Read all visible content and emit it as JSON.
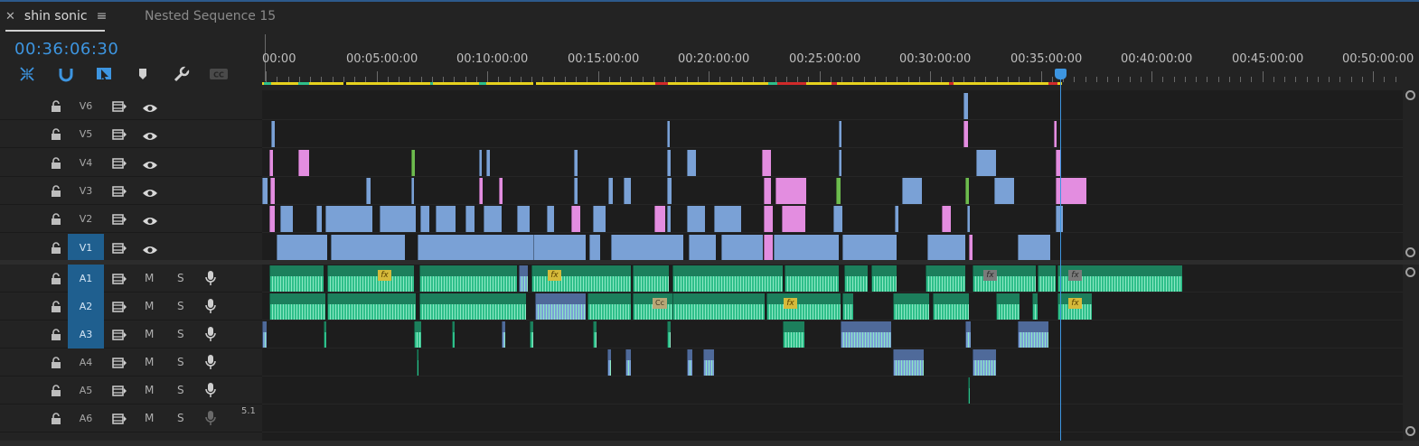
{
  "tabs": {
    "active": "shin sonic",
    "inactive": "Nested Sequence 15"
  },
  "timecode": "00:36:06:30",
  "tools": [
    "snap-in-timeline-icon",
    "linked-selection-icon",
    "insert-overwrite-icon",
    "add-marker-icon",
    "settings-wrench-icon",
    "captions-icon"
  ],
  "ruler": {
    "labels": [
      "00:00",
      "00:05:00:00",
      "00:10:00:00",
      "00:15:00:00",
      "00:20:00:00",
      "00:25:00:00",
      "00:30:00:00",
      "00:35:00:00",
      "00:40:00:00",
      "00:45:00:00",
      "00:50:00:00"
    ]
  },
  "video_tracks": [
    {
      "name": "V6",
      "targeted": false
    },
    {
      "name": "V5",
      "targeted": false
    },
    {
      "name": "V4",
      "targeted": false
    },
    {
      "name": "V3",
      "targeted": false
    },
    {
      "name": "V2",
      "targeted": false
    },
    {
      "name": "V1",
      "targeted": true
    }
  ],
  "audio_tracks": [
    {
      "name": "A1",
      "targeted": true,
      "mute": "M",
      "solo": "S"
    },
    {
      "name": "A2",
      "targeted": true,
      "mute": "M",
      "solo": "S"
    },
    {
      "name": "A3",
      "targeted": true,
      "mute": "M",
      "solo": "S"
    },
    {
      "name": "A4",
      "targeted": false,
      "mute": "M",
      "solo": "S"
    },
    {
      "name": "A5",
      "targeted": false,
      "mute": "M",
      "solo": "S"
    },
    {
      "name": "A6",
      "targeted": false,
      "mute": "M",
      "solo": "S",
      "extra": "5.1"
    }
  ],
  "colors": {
    "accent": "#3d95e0",
    "video_clip": "#7aa1d6",
    "pink_clip": "#e38de0",
    "audio_clip": "#2fbf8a",
    "audio_wave": "#8ce8c4",
    "fx_badge": "#d6ba3a",
    "render_bar": "#e7d21e"
  },
  "badges": {
    "fx": "fx",
    "cc": "Cc"
  }
}
